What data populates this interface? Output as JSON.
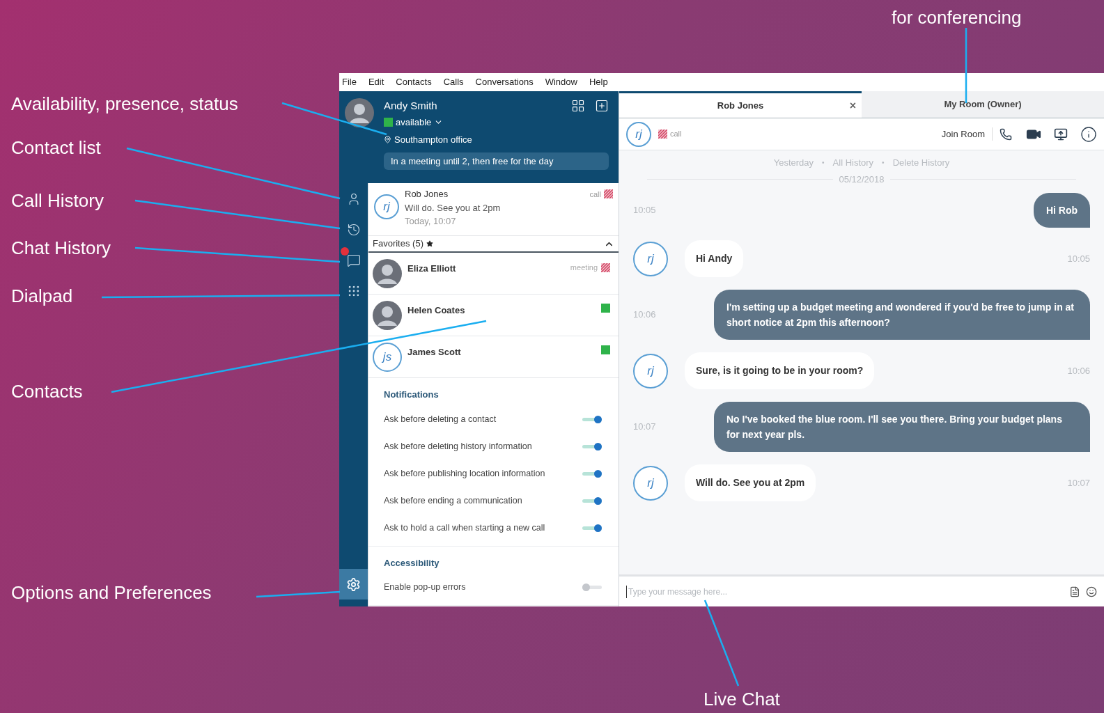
{
  "annotations": [
    {
      "text": "Availability, presence, status"
    },
    {
      "text": "Contact list"
    },
    {
      "text": "Call History"
    },
    {
      "text": "Chat History"
    },
    {
      "text": "Dialpad"
    },
    {
      "text": "Contacts"
    },
    {
      "text": "Options and Preferences"
    },
    {
      "text": "Live Chat"
    },
    {
      "text": "for conferencing"
    }
  ],
  "menu": [
    "File",
    "Edit",
    "Contacts",
    "Calls",
    "Conversations",
    "Window",
    "Help"
  ],
  "profile": {
    "name": "Andy Smith",
    "presence": {
      "kind": "available"
    },
    "status": "available",
    "location": "Southampton office",
    "note": "In a meeting until 2, then free for the day"
  },
  "recent": {
    "initials": "rj",
    "name": "Rob Jones",
    "message": "Will do. See you at 2pm",
    "time": "Today, 10:07",
    "status": "call",
    "presence": {
      "kind": "busy"
    }
  },
  "favorites": {
    "title": "Favorites (5)",
    "expanded": true,
    "contacts": [
      {
        "kind": "photo",
        "name": "Eliza Elliott",
        "status": "meeting",
        "presence": {
          "kind": "busy"
        }
      },
      {
        "kind": "photo",
        "name": "Helen Coates",
        "presence": {
          "kind": "available"
        }
      },
      {
        "kind": "initials",
        "initials": "js",
        "name": "James Scott",
        "presence": {
          "kind": "available"
        }
      }
    ]
  },
  "settings": [
    {
      "title": "Notifications",
      "items": [
        {
          "label": "Ask before deleting a contact",
          "on": true
        },
        {
          "label": "Ask before deleting history information",
          "on": true
        },
        {
          "label": "Ask before publishing location information",
          "on": true
        },
        {
          "label": "Ask before ending a communication",
          "on": true
        },
        {
          "label": "Ask to hold a call when starting a new call",
          "on": true
        }
      ]
    },
    {
      "title": "Accessibility",
      "items": [
        {
          "label": "Enable pop-up errors",
          "on": false
        }
      ]
    }
  ],
  "chat": {
    "tabs": [
      {
        "label": "Rob Jones",
        "selected": true,
        "close": "×"
      },
      {
        "label": "My Room (Owner)",
        "selected": false
      }
    ],
    "header": {
      "initials": "rj",
      "presence": {
        "kind": "busy"
      },
      "status": "call",
      "join": "Join Room"
    },
    "history_links": [
      "Yesterday",
      "All History",
      "Delete History"
    ],
    "history_separators": [
      "•",
      "•"
    ],
    "date": "05/12/2018",
    "messages": [
      {
        "kind": "sent",
        "text": "Hi Rob",
        "time": "10:05"
      },
      {
        "kind": "received",
        "initials": "rj",
        "text": "Hi Andy",
        "time": "10:05"
      },
      {
        "kind": "sent",
        "text": "I'm setting up a budget meeting and wondered if you'd be free to jump in at short notice at 2pm this afternoon?",
        "time": "10:06"
      },
      {
        "kind": "received",
        "initials": "rj",
        "text": "Sure, is it going to be in your room?",
        "time": "10:06"
      },
      {
        "kind": "sent",
        "text": "No I've booked the blue room. I'll see you there. Bring your budget plans for next year pls.",
        "time": "10:07"
      },
      {
        "kind": "received",
        "initials": "rj",
        "text": "Will do. See you at 2pm",
        "time": "10:07"
      }
    ],
    "input": {
      "placeholder": "Type your message here..."
    }
  }
}
